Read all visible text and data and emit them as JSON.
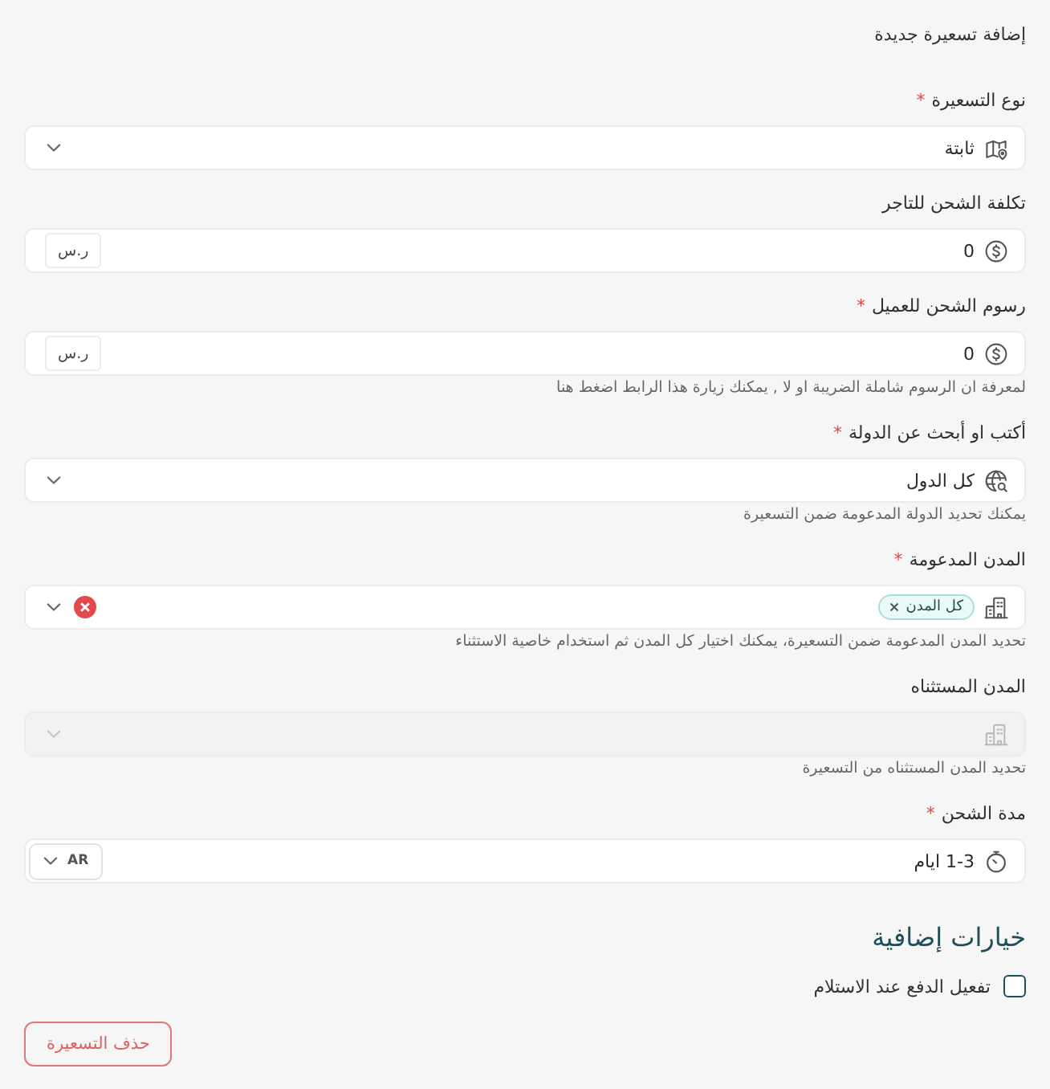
{
  "title": "إضافة تسعيرة جديدة",
  "fields": [
    {
      "kind": "select",
      "label": "نوع التسعيرة",
      "required_mark": "*",
      "value": "ثابتة",
      "disabled": false
    },
    {
      "kind": "amount",
      "label": "تكلفة الشحن للتاجر",
      "value": "0",
      "unit": "ر.س",
      "disabled": false
    },
    {
      "kind": "amount",
      "label": "رسوم الشحن للعميل",
      "required_mark": "*",
      "value": "0",
      "unit": "ر.س",
      "hint": "لمعرفة ان الرسوم شاملة الضريبة او لا , يمكنك زيارة هذا الرابط اضغط هنا",
      "disabled": false
    },
    {
      "kind": "country",
      "label": "أكتب او أبحث عن الدولة",
      "required_mark": "*",
      "value": "كل الدول",
      "hint": "يمكنك تحديد الدولة المدعومة ضمن التسعيرة",
      "disabled": false
    },
    {
      "kind": "cities",
      "label": "المدن المدعومة",
      "required_mark": "*",
      "tags": [
        {
          "label": "كل المدن"
        }
      ],
      "hint": "تحديد المدن المدعومة ضمن التسعيرة، يمكنك اختيار كل المدن ثم استخدام خاصية الاستثناء",
      "disabled": false
    },
    {
      "kind": "cities",
      "label": "المدن المستثناه",
      "hint": "تحديد المدن المستثناه من التسعيرة",
      "disabled": true
    },
    {
      "kind": "duration",
      "label": "مدة الشحن",
      "required_mark": "*",
      "value": "1-3 ايام",
      "language": "AR",
      "disabled": false
    }
  ],
  "options": {
    "title": "خيارات إضافية",
    "checkboxes": [
      {
        "label": "تفعيل الدفع عند الاستلام",
        "checked": false
      }
    ]
  },
  "delete_button": "حذف التسعيرة"
}
